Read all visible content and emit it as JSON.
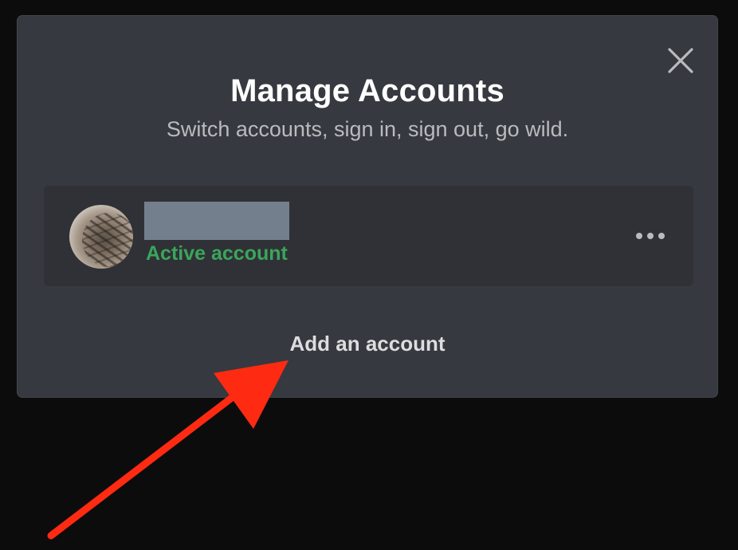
{
  "modal": {
    "title": "Manage Accounts",
    "subtitle": "Switch accounts, sign in, sign out, go wild.",
    "close_icon": "close-icon"
  },
  "account": {
    "status": "Active account",
    "status_color": "#3ba55c",
    "avatar_icon": "cat-avatar",
    "more_icon": "more-options-icon"
  },
  "actions": {
    "add_account_label": "Add an account"
  },
  "annotation": {
    "arrow_color": "#ff2a12"
  }
}
